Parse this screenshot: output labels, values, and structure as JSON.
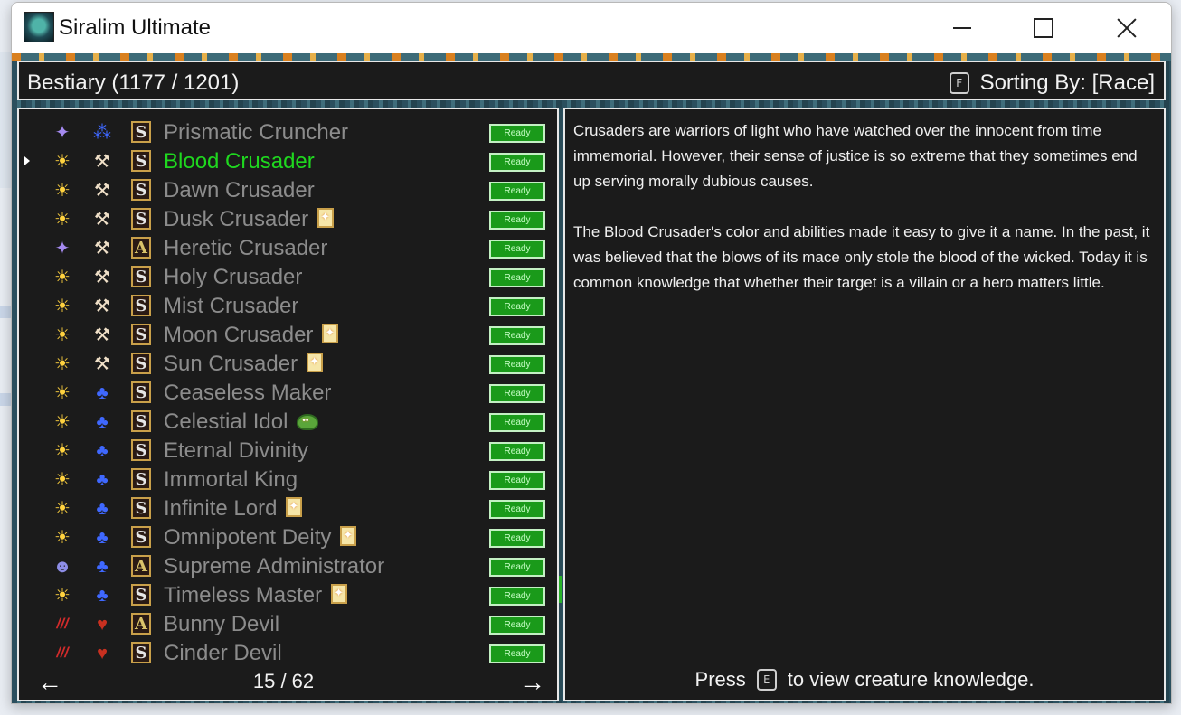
{
  "window": {
    "title": "Siralim Ultimate"
  },
  "header": {
    "title": "Bestiary (1177 / 1201)",
    "sort_key": "F",
    "sort_label": "Sorting By: [Race]"
  },
  "creatures": [
    {
      "name": "Prismatic Cruncher",
      "cls": "purple-star",
      "race": "blue-blob",
      "tier": "S",
      "extra": "",
      "status": "Ready"
    },
    {
      "name": "Blood Crusader",
      "cls": "sun",
      "race": "hammer",
      "tier": "S",
      "extra": "",
      "status": "Ready",
      "selected": true
    },
    {
      "name": "Dawn Crusader",
      "cls": "sun",
      "race": "hammer",
      "tier": "S",
      "extra": "",
      "status": "Ready"
    },
    {
      "name": "Dusk Crusader",
      "cls": "sun",
      "race": "hammer",
      "tier": "S",
      "extra": "card",
      "status": "Ready"
    },
    {
      "name": "Heretic Crusader",
      "cls": "purple-star",
      "race": "hammer",
      "tier": "A",
      "extra": "",
      "status": "Ready"
    },
    {
      "name": "Holy Crusader",
      "cls": "sun",
      "race": "hammer",
      "tier": "S",
      "extra": "",
      "status": "Ready"
    },
    {
      "name": "Mist Crusader",
      "cls": "sun",
      "race": "hammer",
      "tier": "S",
      "extra": "",
      "status": "Ready"
    },
    {
      "name": "Moon Crusader",
      "cls": "sun",
      "race": "hammer",
      "tier": "S",
      "extra": "card",
      "status": "Ready"
    },
    {
      "name": "Sun Crusader",
      "cls": "sun",
      "race": "hammer",
      "tier": "S",
      "extra": "card",
      "status": "Ready"
    },
    {
      "name": "Ceaseless Maker",
      "cls": "sun",
      "race": "divine",
      "tier": "S",
      "extra": "",
      "status": "Ready"
    },
    {
      "name": "Celestial Idol",
      "cls": "sun",
      "race": "divine",
      "tier": "S",
      "extra": "slime",
      "status": "Ready"
    },
    {
      "name": "Eternal Divinity",
      "cls": "sun",
      "race": "divine",
      "tier": "S",
      "extra": "",
      "status": "Ready"
    },
    {
      "name": "Immortal King",
      "cls": "sun",
      "race": "divine",
      "tier": "S",
      "extra": "",
      "status": "Ready"
    },
    {
      "name": "Infinite Lord",
      "cls": "sun",
      "race": "divine",
      "tier": "S",
      "extra": "card",
      "status": "Ready"
    },
    {
      "name": "Omnipotent Deity",
      "cls": "sun",
      "race": "divine",
      "tier": "S",
      "extra": "card",
      "status": "Ready"
    },
    {
      "name": "Supreme Administrator",
      "cls": "grey-face",
      "race": "divine",
      "tier": "A",
      "extra": "",
      "status": "Ready"
    },
    {
      "name": "Timeless Master",
      "cls": "sun",
      "race": "divine",
      "tier": "S",
      "extra": "card",
      "status": "Ready"
    },
    {
      "name": "Bunny Devil",
      "cls": "blood-claw",
      "race": "devil",
      "tier": "A",
      "extra": "",
      "status": "Ready"
    },
    {
      "name": "Cinder Devil",
      "cls": "blood-claw",
      "race": "devil",
      "tier": "S",
      "extra": "",
      "status": "Ready"
    }
  ],
  "pager": {
    "text": "15 / 62",
    "prev": "←",
    "next": "→"
  },
  "description": {
    "p1": "Crusaders are warriors of light who have watched over the innocent from time immemorial. However, their sense of justice is so extreme that they sometimes end up serving morally dubious causes.",
    "p2": "The Blood Crusader's color and abilities made it easy to give it a name. In the past, it was believed that the blows of its mace only stole the blood of the wicked. Today it is common knowledge that whether their target is a villain or a hero matters little."
  },
  "footer": {
    "press": "Press",
    "key": "E",
    "action": "to view creature knowledge."
  }
}
